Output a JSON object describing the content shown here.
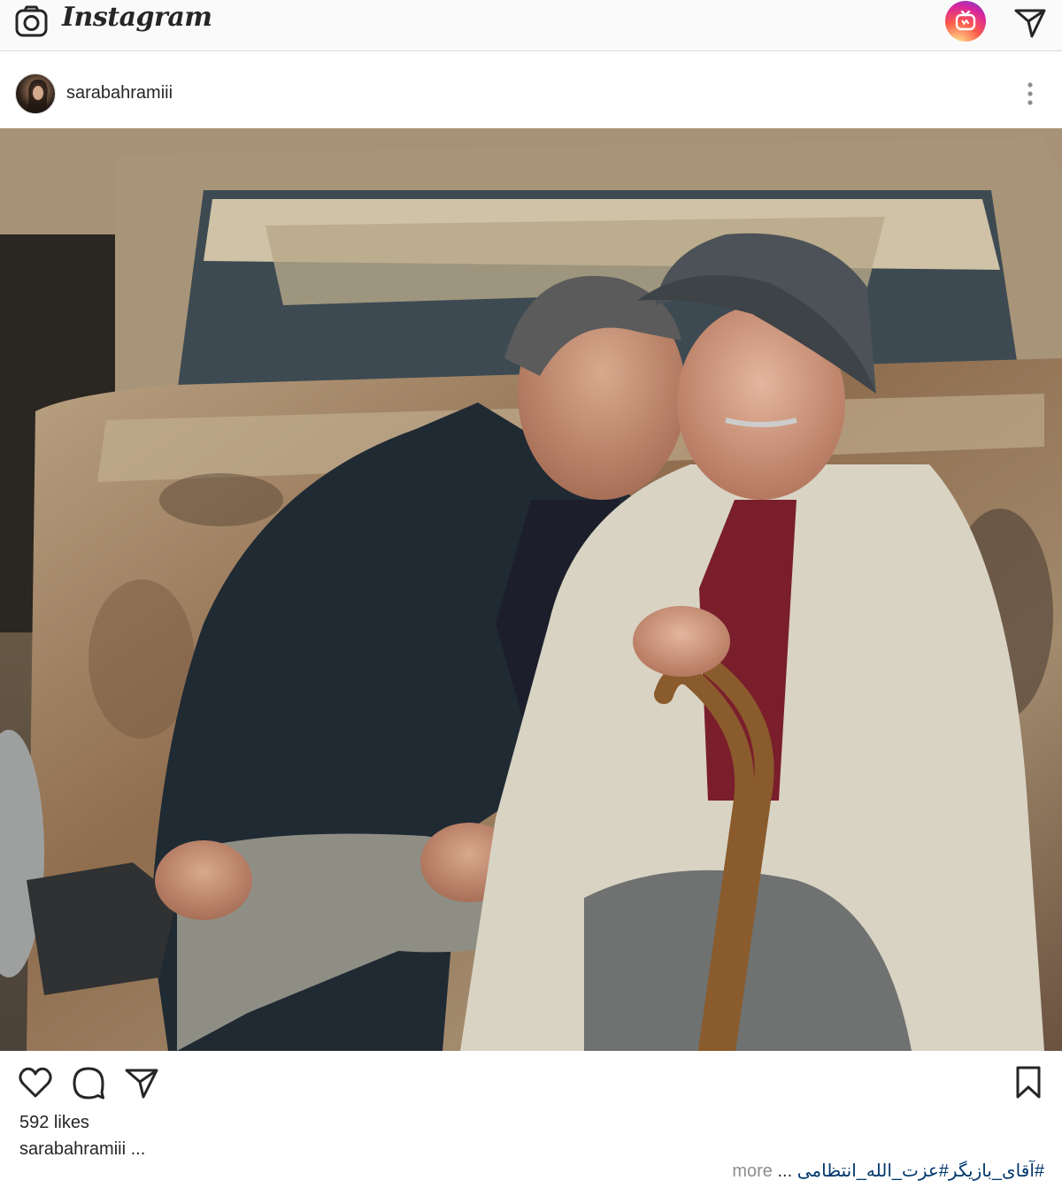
{
  "app": {
    "title": "Instagram"
  },
  "post": {
    "username": "sarabahramiii",
    "likes": "592 likes",
    "caption_user": "sarabahramiii ...",
    "hashtags": "#آقای_بازیگر#عزت_الله_انتظامی",
    "ellipsis": "...",
    "more": "more"
  },
  "icons": {
    "camera": "camera-icon",
    "igtv": "igtv-icon",
    "direct": "direct-message-icon",
    "options": "more-options-icon",
    "like": "heart-icon",
    "comment": "comment-icon",
    "share": "share-icon",
    "save": "bookmark-icon"
  },
  "colors": {
    "accent_link": "#00376b",
    "muted": "#8e8e8e",
    "text": "#262626"
  }
}
